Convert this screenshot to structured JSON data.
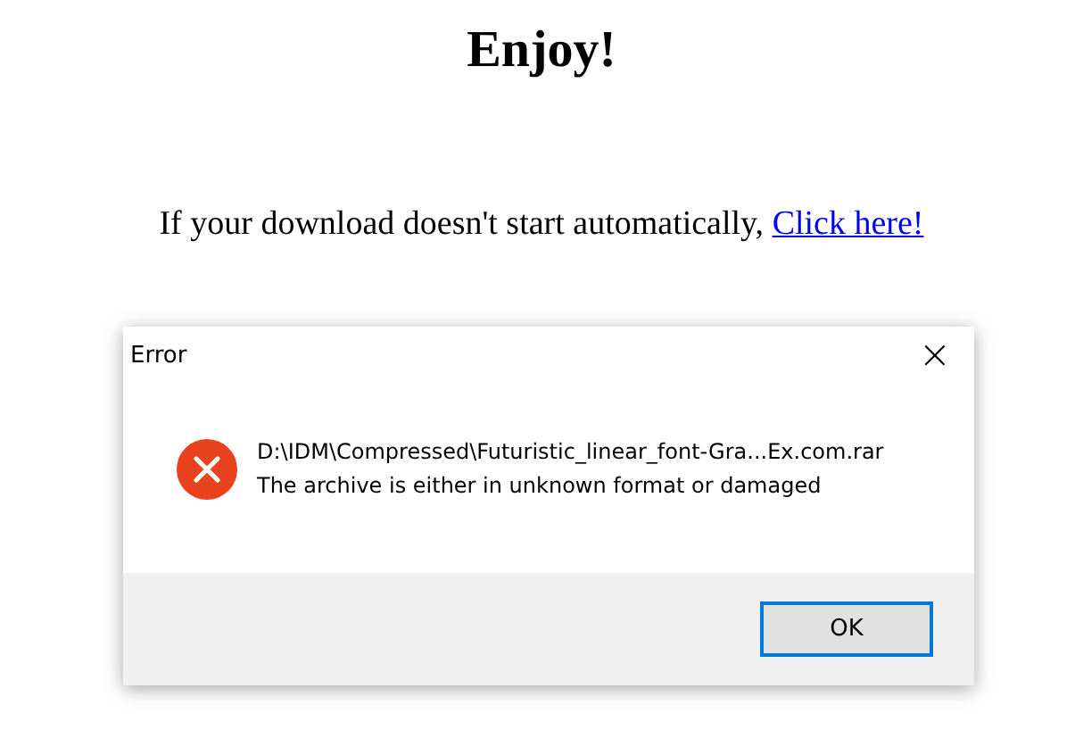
{
  "page": {
    "heading": "Enjoy!",
    "message": "If your download doesn't start automatically,",
    "link": "Click here!"
  },
  "dialog": {
    "title": "Error",
    "close": "×",
    "lines": [
      "D:\\IDM\\Compressed\\Futuristic_linear_font-Gra...Ex.com.rar",
      "The archive is either in unknown format or damaged"
    ],
    "buttons": [
      {
        "label": "OK",
        "selected": true
      }
    ]
  }
}
